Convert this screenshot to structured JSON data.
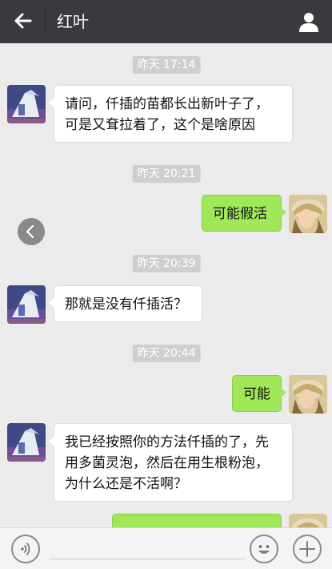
{
  "header": {
    "title": "红叶"
  },
  "messages": [
    {
      "time": "昨天 17:14"
    },
    {
      "from": "in",
      "text": "请问，仟插的苗都长出新叶子了，可是又耷拉着了，这个是啥原因"
    },
    {
      "time": "昨天 20:21"
    },
    {
      "from": "out",
      "text": "可能假活"
    },
    {
      "time": "昨天 20:39"
    },
    {
      "from": "in",
      "text": "那就是没有仟插活？"
    },
    {
      "time": "昨天 20:44"
    },
    {
      "from": "out",
      "text": "可能"
    },
    {
      "from": "in",
      "text": "我已经按照你的方法仟插的了，先用多菌灵泡，然后在用生根粉泡，为什么还是不活啊？"
    }
  ],
  "icons": [
    "back-arrow-icon",
    "profile-icon",
    "voice-icon",
    "emoji-icon",
    "plus-icon",
    "chevron-left-icon"
  ],
  "colors": {
    "topbar": "#393a3f",
    "background": "#ebebeb",
    "bubble_out": "#a0e759",
    "bubble_in": "#ffffff",
    "timestamp_bg": "#cfcfcf"
  }
}
